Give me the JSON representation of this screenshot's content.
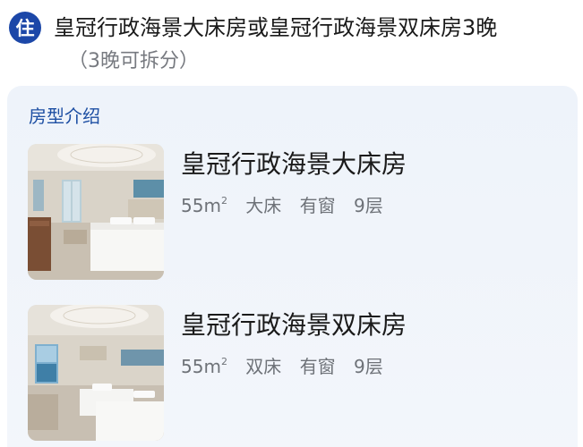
{
  "header": {
    "badge": "住",
    "title": "皇冠行政海景大床房或皇冠行政海景双床房3晚",
    "subtitle": "（3晚可拆分）"
  },
  "section": {
    "title": "房型介绍",
    "rooms": [
      {
        "name": "皇冠行政海景大床房",
        "area": "55m",
        "area_sup": "2",
        "bed": "大床",
        "window": "有窗",
        "floor": "9层"
      },
      {
        "name": "皇冠行政海景双床房",
        "area": "55m",
        "area_sup": "2",
        "bed": "双床",
        "window": "有窗",
        "floor": "9层"
      }
    ]
  },
  "colors": {
    "badge": "#1c47a8",
    "section_title": "#1d4fa3",
    "card_bg": "#eef3fa"
  }
}
